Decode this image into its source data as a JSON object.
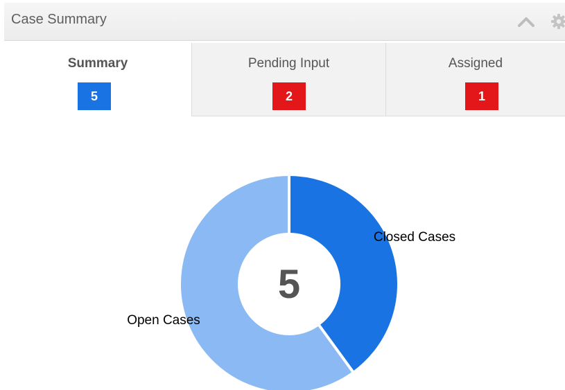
{
  "header": {
    "title": "Case Summary",
    "collapse_icon": "chevron-up-icon",
    "settings_icon": "gear-icon"
  },
  "tabs": [
    {
      "label": "Summary",
      "count": "5",
      "badge_color": "#1a73e3",
      "active": true
    },
    {
      "label": "Pending Input",
      "count": "2",
      "badge_color": "#e3161a",
      "active": false
    },
    {
      "label": "Assigned",
      "count": "1",
      "badge_color": "#e3161a",
      "active": false
    }
  ],
  "chart_data": {
    "type": "pie",
    "variant": "donut",
    "center_label": "5",
    "slices": [
      {
        "label": "Closed Cases",
        "value": 2,
        "color": "#1a73e3"
      },
      {
        "label": "Open Cases",
        "value": 3,
        "color": "#8ab9f3"
      }
    ]
  }
}
